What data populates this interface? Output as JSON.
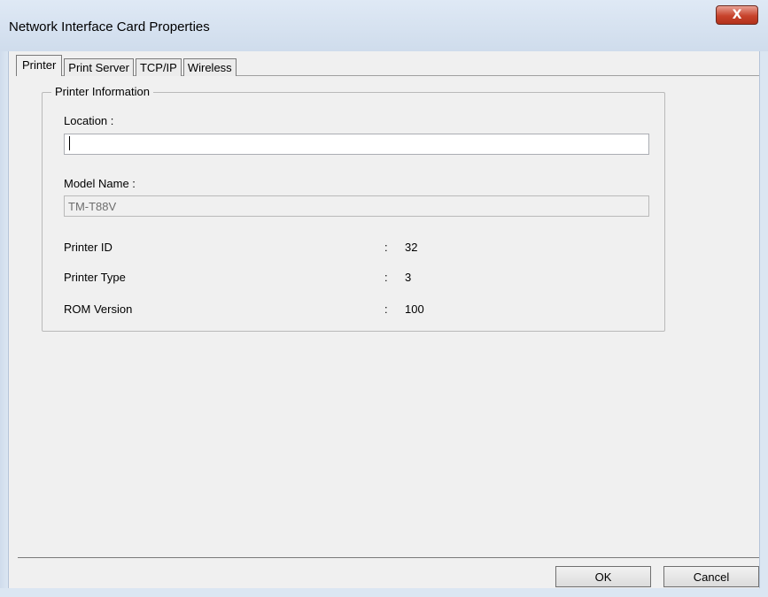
{
  "window": {
    "title": "Network Interface Card Properties",
    "close_glyph": "X"
  },
  "tabs": [
    {
      "label": "Printer",
      "active": true
    },
    {
      "label": "Print Server",
      "active": false
    },
    {
      "label": "TCP/IP",
      "active": false
    },
    {
      "label": "Wireless",
      "active": false
    }
  ],
  "group": {
    "title": "Printer Information",
    "location": {
      "label": "Location :",
      "value": ""
    },
    "model_name": {
      "label": "Model Name :",
      "value": "TM-T88V"
    },
    "info_rows": [
      {
        "label": "Printer ID",
        "colon": ":",
        "value": "32"
      },
      {
        "label": "Printer Type",
        "colon": ":",
        "value": "3"
      },
      {
        "label": "ROM Version",
        "colon": ":",
        "value": "100"
      }
    ]
  },
  "buttons": {
    "ok": "OK",
    "cancel": "Cancel"
  },
  "colors": {
    "titlebar": "#cfdcec",
    "close": "#c7432c",
    "face": "#f0f0f0"
  }
}
